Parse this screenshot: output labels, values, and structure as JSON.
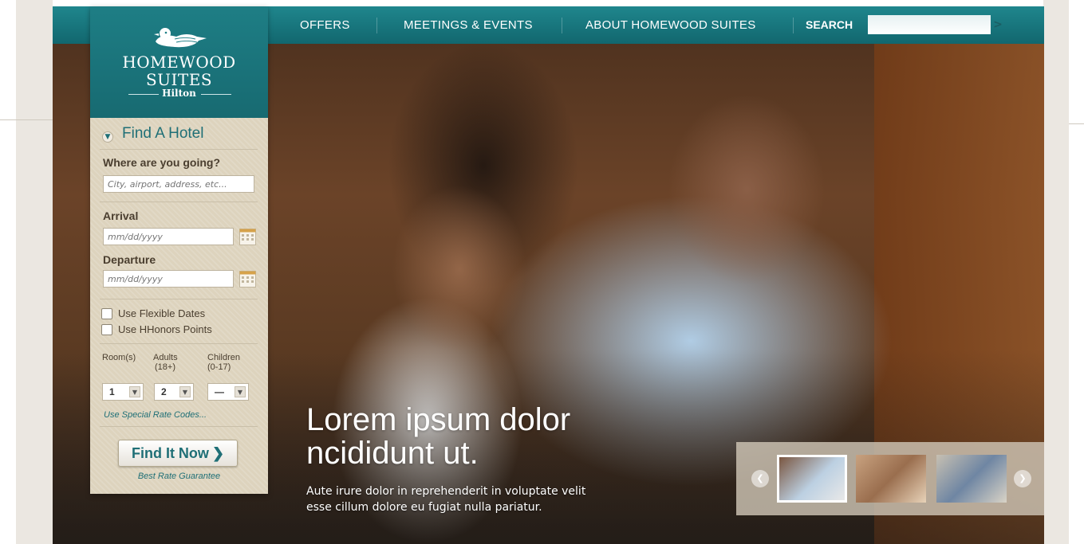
{
  "nav": {
    "items": [
      "OFFERS",
      "MEETINGS & EVENTS",
      "ABOUT HOMEWOOD SUITES"
    ],
    "search_label": "SEARCH",
    "search_go": ">"
  },
  "brand": {
    "line1": "HOMEWOOD",
    "line2": "SUITES",
    "line3": "Hilton"
  },
  "find_hotel": {
    "title": "Find A Hotel",
    "destination_label": "Where are you going?",
    "destination_placeholder": "City, airport, address, etc...",
    "arrival_label": "Arrival",
    "arrival_placeholder": "mm/dd/yyyy",
    "departure_label": "Departure",
    "departure_placeholder": "mm/dd/yyyy",
    "flexible_dates": "Use Flexible Dates",
    "hhonors_points": "Use HHonors Points",
    "rooms_label": "Room(s)",
    "adults_label": "Adults",
    "adults_sub": "(18+)",
    "children_label": "Children",
    "children_sub": "(0-17)",
    "rooms_value": "1",
    "adults_value": "2",
    "children_value": "—",
    "special_rate_link": "Use Special Rate Codes...",
    "submit_label": "Find It Now",
    "submit_arrow": "❯",
    "best_rate": "Best Rate Guarantee"
  },
  "hero": {
    "headline_line1": "Lorem ipsum dolor",
    "headline_line2": "ncididunt ut.",
    "sub_line1": "Aute irure dolor in reprehenderit in voluptate velit",
    "sub_line2": "esse cillum dolore eu fugiat nulla pariatur."
  },
  "carousel": {
    "prev": "❮",
    "next": "❯",
    "active_index": 0,
    "count": 3
  },
  "colors": {
    "nav_teal": "#17757c",
    "panel_tan": "#ddd3bd",
    "accent_teal": "#1f6f76"
  }
}
